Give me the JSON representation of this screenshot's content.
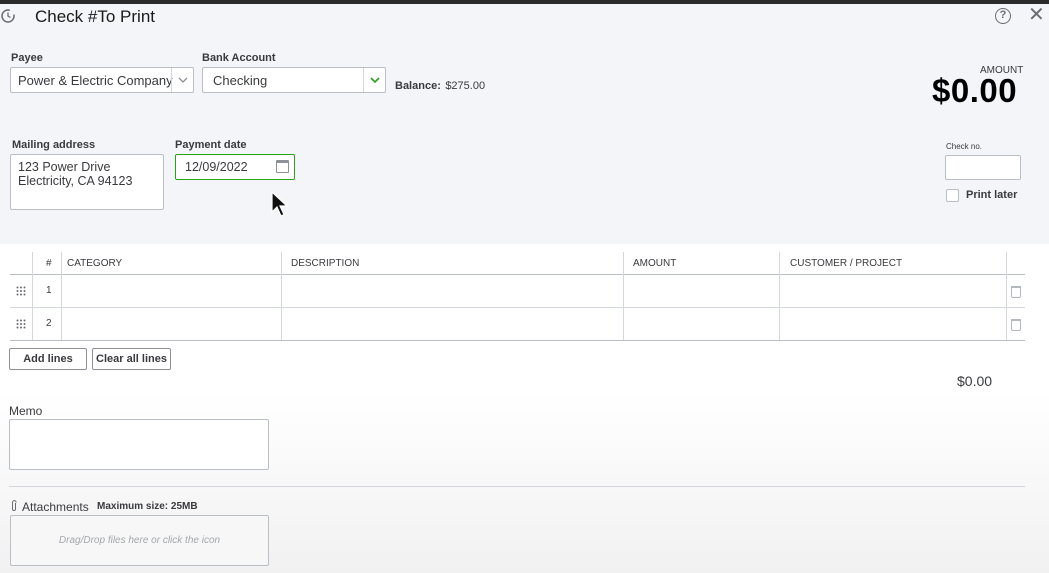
{
  "window": {
    "title": "Check #To Print",
    "help_icon": "question-circle-icon",
    "close_icon": "close-icon",
    "history_icon": "history-icon"
  },
  "payee": {
    "label": "Payee",
    "value": "Power & Electric Company"
  },
  "bank_account": {
    "label": "Bank Account",
    "value": "Checking",
    "balance_label": "Balance:",
    "balance_value": "$275.00"
  },
  "amount": {
    "label": "AMOUNT",
    "value": "$0.00"
  },
  "mailing_address": {
    "label": "Mailing address",
    "line1": "123 Power Drive",
    "line2": "Electricity, CA 94123"
  },
  "payment_date": {
    "label": "Payment date",
    "value": "12/09/2022"
  },
  "check_no": {
    "label": "Check no.",
    "value": ""
  },
  "print_later": {
    "label": "Print later",
    "checked": false
  },
  "table": {
    "headers": {
      "num": "#",
      "category": "CATEGORY",
      "description": "DESCRIPTION",
      "amount": "AMOUNT",
      "customer": "CUSTOMER / PROJECT"
    },
    "rows": [
      {
        "num": "1",
        "category": "",
        "description": "",
        "amount": "",
        "customer": ""
      },
      {
        "num": "2",
        "category": "",
        "description": "",
        "amount": "",
        "customer": ""
      }
    ]
  },
  "buttons": {
    "add_lines": "Add lines",
    "clear_all_lines": "Clear all lines"
  },
  "total": "$0.00",
  "memo": {
    "label": "Memo",
    "value": ""
  },
  "attachments": {
    "label": "Attachments",
    "max_size": "Maximum size: 25MB",
    "drop_text": "Drag/Drop files here or click the icon"
  },
  "colors": {
    "accent_green": "#2ca01c",
    "border": "#babec5",
    "text": "#393a3d"
  }
}
